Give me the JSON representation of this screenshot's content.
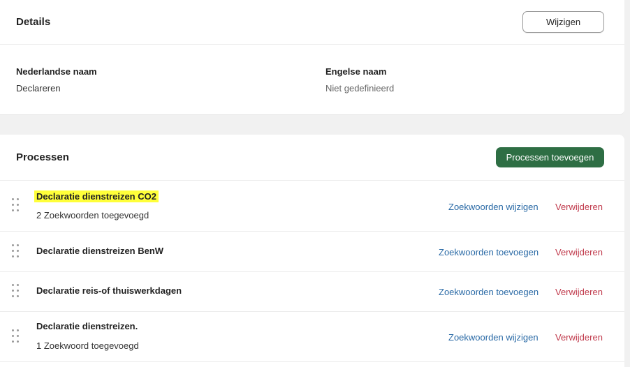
{
  "details": {
    "title": "Details",
    "edit_label": "Wijzigen",
    "fields": [
      {
        "label": "Nederlandse naam",
        "value": "Declareren"
      },
      {
        "label": "Engelse naam",
        "value": "Niet gedefinieerd"
      }
    ]
  },
  "processes": {
    "title": "Processen",
    "add_label": "Processen toevoegen",
    "items": [
      {
        "title": "Declaratie dienstreizen CO2",
        "subtitle": "2 Zoekwoorden toegevoegd",
        "action": "Zoekwoorden wijzigen",
        "delete": "Verwijderen"
      },
      {
        "title": "Declaratie dienstreizen BenW",
        "subtitle": "",
        "action": "Zoekwoorden toevoegen",
        "delete": "Verwijderen"
      },
      {
        "title": "Declaratie reis-of thuiswerkdagen",
        "subtitle": "",
        "action": "Zoekwoorden toevoegen",
        "delete": "Verwijderen"
      },
      {
        "title": "Declaratie dienstreizen.",
        "subtitle": "1 Zoekwoord toegevoegd",
        "action": "Zoekwoorden wijzigen",
        "delete": "Verwijderen"
      }
    ]
  },
  "colors": {
    "primary": "#2e6e44",
    "link": "#2a6aa6",
    "danger": "#c0394b",
    "highlight": "#ffff3a"
  }
}
